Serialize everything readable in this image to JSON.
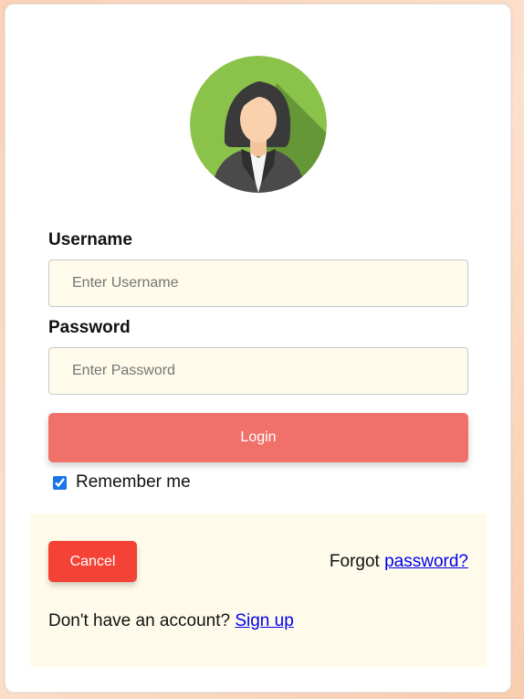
{
  "avatar": {
    "icon": "user-avatar-icon",
    "bg_color": "#8bc34a"
  },
  "form": {
    "username_label": "Username",
    "username_placeholder": "Enter Username",
    "username_value": "",
    "password_label": "Password",
    "password_placeholder": "Enter Password",
    "password_value": "",
    "login_label": "Login",
    "remember_label": "Remember me",
    "remember_checked": true
  },
  "footer": {
    "cancel_label": "Cancel",
    "forgot_prefix": "Forgot ",
    "forgot_link": "password?",
    "signup_prefix": "Don't have an account? ",
    "signup_link": "Sign up"
  },
  "colors": {
    "login_button": "#f0716a",
    "cancel_button": "#f44336",
    "input_bg": "#fffbea",
    "footer_bg": "#fffbea",
    "link": "#0000ee"
  }
}
